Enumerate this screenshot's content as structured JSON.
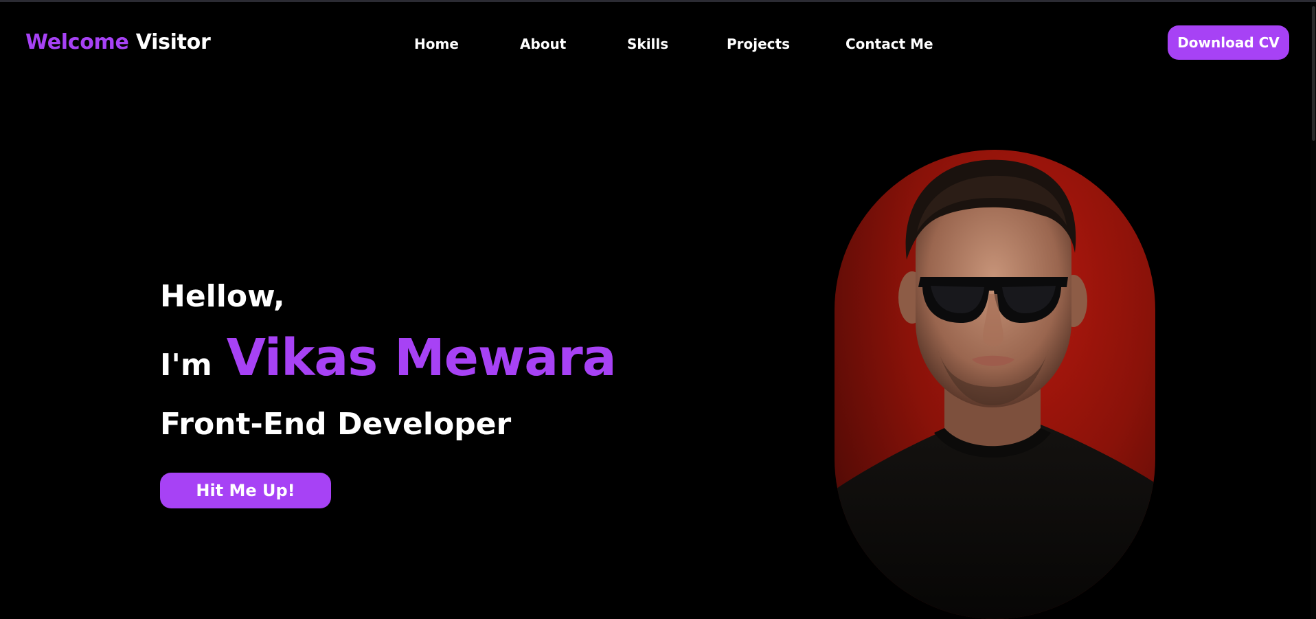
{
  "header": {
    "brand_accent": "Welcome",
    "brand_rest": "Visitor",
    "nav": [
      {
        "label": "Home"
      },
      {
        "label": "About"
      },
      {
        "label": "Skills"
      },
      {
        "label": "Projects"
      },
      {
        "label": "Contact Me"
      }
    ],
    "cv_button": "Download CV"
  },
  "hero": {
    "greeting": "Hellow,",
    "im": "I'm",
    "name": "Vikas Mewara",
    "role": "Front-End Developer",
    "cta": "Hit Me Up!"
  },
  "colors": {
    "accent": "#a742f5",
    "background": "#000000",
    "portrait_bg": "#9e150b"
  },
  "icons": {
    "portrait": "person-portrait-image"
  }
}
